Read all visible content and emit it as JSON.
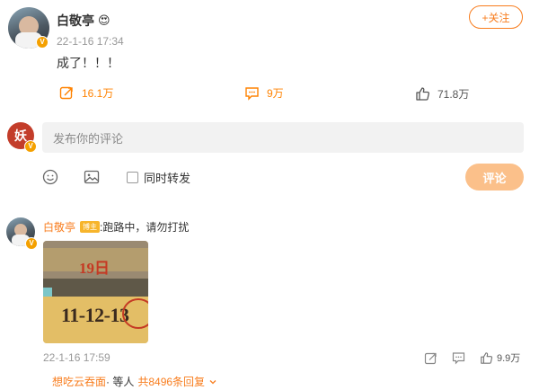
{
  "post": {
    "author": "白敬亭",
    "emoji": "😍",
    "follow_label": "+关注",
    "time": "22-1-16 17:34",
    "text": "成了！！！",
    "repost_count": "16.1万",
    "comment_count": "9万",
    "like_count": "71.8万"
  },
  "composer": {
    "placeholder": "发布你的评论",
    "repost_label": "同时转发",
    "submit_label": "评论"
  },
  "comment": {
    "author": "白敬亭",
    "badge": "博主",
    "text": ":跑路中，请勿打扰",
    "image_day": "19日",
    "image_numbers": "11-12-13",
    "time": "22-1-16 17:59",
    "like_count": "9.9万",
    "reply_user": "想吃云吞面",
    "reply_suffix": "· 等人",
    "reply_total": "共8496条回复"
  },
  "colors": {
    "accent": "#ff8200",
    "button": "#fbc08a",
    "input_bg": "#f2f2f2"
  }
}
